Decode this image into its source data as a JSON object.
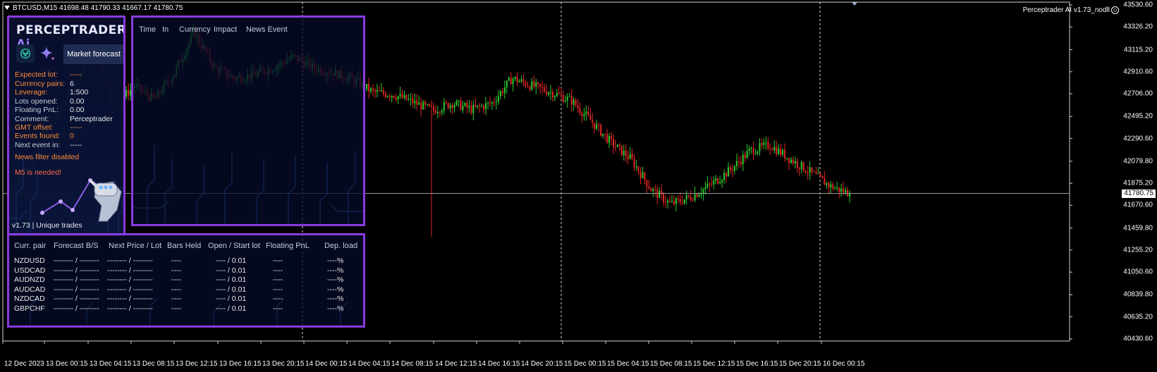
{
  "chart": {
    "header": "BTCUSD,M15  41698.48 41790.33 41667.17 41780.75",
    "ea_label": "Perceptrader AI v1.73_nodll",
    "current_price": "41780.75",
    "price_axis": [
      {
        "label": "43530.60",
        "price": 43530.6
      },
      {
        "label": "43326.20",
        "price": 43326.2
      },
      {
        "label": "43115.20",
        "price": 43115.2
      },
      {
        "label": "42910.60",
        "price": 42910.6
      },
      {
        "label": "42706.00",
        "price": 42706.0
      },
      {
        "label": "42495.20",
        "price": 42495.2
      },
      {
        "label": "42290.60",
        "price": 42290.6
      },
      {
        "label": "42079.80",
        "price": 42079.8
      },
      {
        "label": "41875.20",
        "price": 41875.2
      },
      {
        "label": "41670.60",
        "price": 41670.6
      },
      {
        "label": "41459.80",
        "price": 41459.8
      },
      {
        "label": "41255.20",
        "price": 41255.2
      },
      {
        "label": "41050.60",
        "price": 41050.6
      },
      {
        "label": "40839.80",
        "price": 40839.8
      },
      {
        "label": "40635.20",
        "price": 40635.2
      },
      {
        "label": "40430.60",
        "price": 40430.6
      }
    ],
    "time_axis": [
      "12 Dec 2023",
      "13 Dec 00:15",
      "13 Dec 04:15",
      "13 Dec 08:15",
      "13 Dec 12:15",
      "13 Dec 16:15",
      "13 Dec 20:15",
      "14 Dec 00:15",
      "14 Dec 04:15",
      "14 Dec 08:15",
      "14 Dec 12:15",
      "14 Dec 16:15",
      "14 Dec 20:15",
      "15 Dec 00:15",
      "15 Dec 04:15",
      "15 Dec 08:15",
      "15 Dec 12:15",
      "15 Dec 16:15",
      "15 Dec 20:15",
      "16 Dec 00:15"
    ],
    "colors": {
      "bull": "#2ecc2e",
      "bear": "#e02525",
      "background": "#000000",
      "grid_day": "#ffffff",
      "current_line": "#9a9a9a",
      "panel_border": "#8a3bdf"
    },
    "price_path": [
      41900,
      42150,
      42500,
      42800,
      43150,
      42600,
      42780,
      42650,
      42900,
      43280,
      42950,
      42850,
      42880,
      42950,
      43050,
      42950,
      42900,
      42840,
      42720,
      42700,
      42630,
      42550,
      42620,
      42560,
      42620,
      42850,
      42780,
      42720,
      42640,
      42450,
      42250,
      42100,
      41820,
      41680,
      41750,
      41860,
      42000,
      42180,
      42230,
      42100,
      41980,
      41850,
      41780
    ]
  },
  "left_panel": {
    "brand_main": "PERCEPTRADER",
    "brand_ai": "Ai",
    "gpt_icon": "openai-icon",
    "gemini_icon": "sparkle-icon",
    "forecast_button": "Market forecast",
    "stats": [
      {
        "key": "Expected lot:",
        "value": "-----",
        "key_color": "orange",
        "value_color": "orange"
      },
      {
        "key": "Currency pairs:",
        "value": "6",
        "key_color": "orange",
        "value_color": "white"
      },
      {
        "key": "Leverage:",
        "value": "1:500",
        "key_color": "orange",
        "value_color": "white"
      },
      {
        "key": "Lots opened:",
        "value": "0.00",
        "key_color": "gray",
        "value_color": "white"
      },
      {
        "key": "Floating PnL:",
        "value": "0.00",
        "key_color": "gray",
        "value_color": "white"
      },
      {
        "key": "Comment:",
        "value": "Perceptrader",
        "key_color": "gray",
        "value_color": "white"
      },
      {
        "key": "GMT offset:",
        "value": "-----",
        "key_color": "orange",
        "value_color": "orange"
      },
      {
        "key": "Events found:",
        "value": "0",
        "key_color": "orange",
        "value_color": "orange"
      },
      {
        "key": "Next event in:",
        "value": "-----",
        "key_color": "gray",
        "value_color": "white"
      }
    ],
    "news_filter": "News filter disabled",
    "m5_warning": "M5 is needed!",
    "version": "v1.73 | Unique trades"
  },
  "news_panel": {
    "headers": [
      "Time",
      "In",
      "Currency",
      "Impact",
      "News Event"
    ]
  },
  "trade_panel": {
    "headers": [
      "Curr. pair",
      "Forecast B/S",
      "Next Price / Lot",
      "Bars Held",
      "Open / Start lot",
      "Floating PnL",
      "Dep. load"
    ],
    "rows": [
      [
        "NZDUSD",
        "-------- / --------",
        "-------- / --------",
        "----",
        "---- / 0.01",
        "----",
        "----%"
      ],
      [
        "USDCAD",
        "-------- / --------",
        "-------- / --------",
        "----",
        "---- / 0.01",
        "----",
        "----%"
      ],
      [
        "AUDNZD",
        "-------- / --------",
        "-------- / --------",
        "----",
        "---- / 0.01",
        "----",
        "----%"
      ],
      [
        "AUDCAD",
        "-------- / --------",
        "-------- / --------",
        "----",
        "---- / 0.01",
        "----",
        "----%"
      ],
      [
        "NZDCAD",
        "-------- / --------",
        "-------- / --------",
        "----",
        "---- / 0.01",
        "----",
        "----%"
      ],
      [
        "GBPCHF",
        "-------- / --------",
        "-------- / --------",
        "----",
        "---- / 0.01",
        "----",
        "----%"
      ]
    ]
  }
}
